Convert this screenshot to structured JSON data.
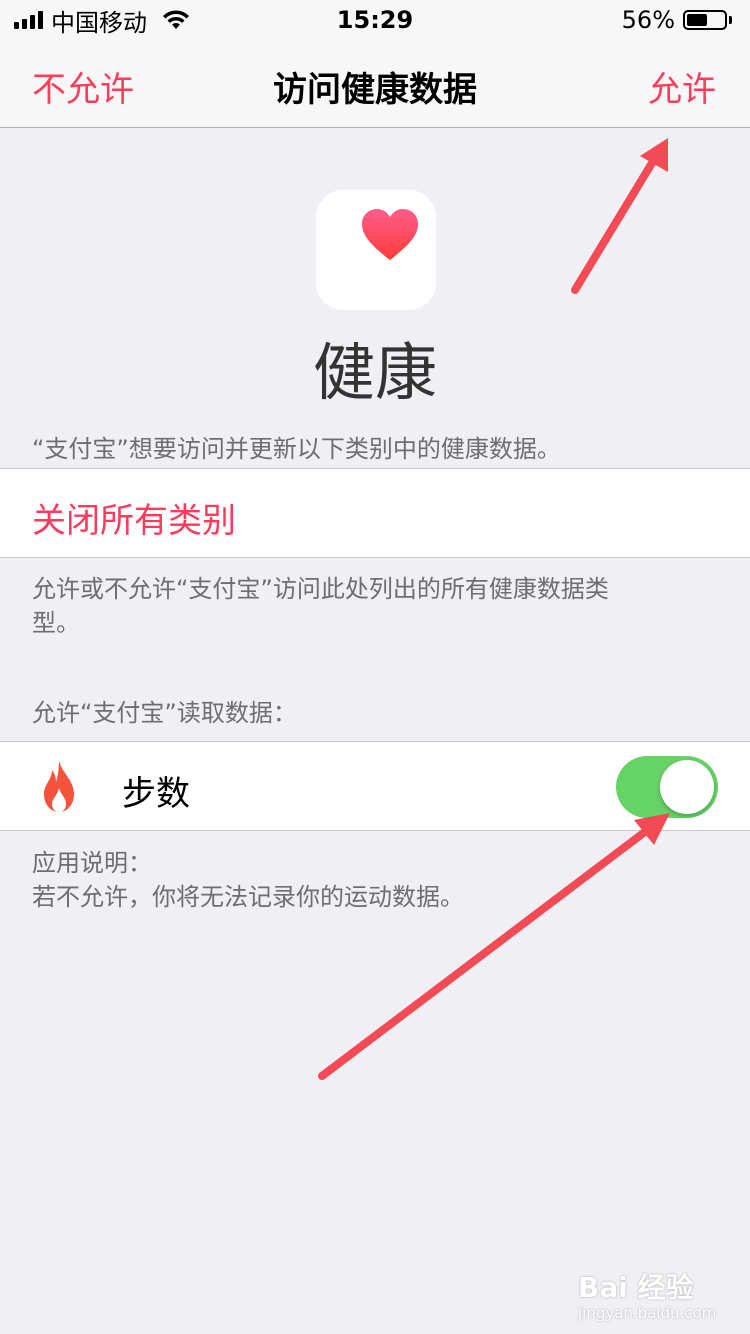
{
  "status_bar": {
    "carrier": "中国移动",
    "time": "15:29",
    "battery_percent": "56%",
    "battery_level": 0.56
  },
  "nav": {
    "left": "不允许",
    "title": "访问健康数据",
    "right": "允许"
  },
  "app": {
    "name": "健康",
    "icon": "heart-icon"
  },
  "intro": "“支付宝”想要访问并更新以下类别中的健康数据。",
  "close_all": "关闭所有类别",
  "note": "允许或不允许“支付宝”访问此处列出的所有健康数据类型。",
  "read_header": "允许“支付宝”读取数据：",
  "steps": {
    "label": "步数",
    "icon": "flame-icon",
    "enabled": true
  },
  "app_note": {
    "title": "应用说明：",
    "body": "若不允许，你将无法记录你的运动数据。"
  },
  "watermark": {
    "logo": "Bai 经验",
    "url": "jingyan.baidu.com"
  },
  "colors": {
    "accent": "#ff3b5c",
    "toggle_on": "#66d366",
    "arrow": "#f24b55"
  }
}
